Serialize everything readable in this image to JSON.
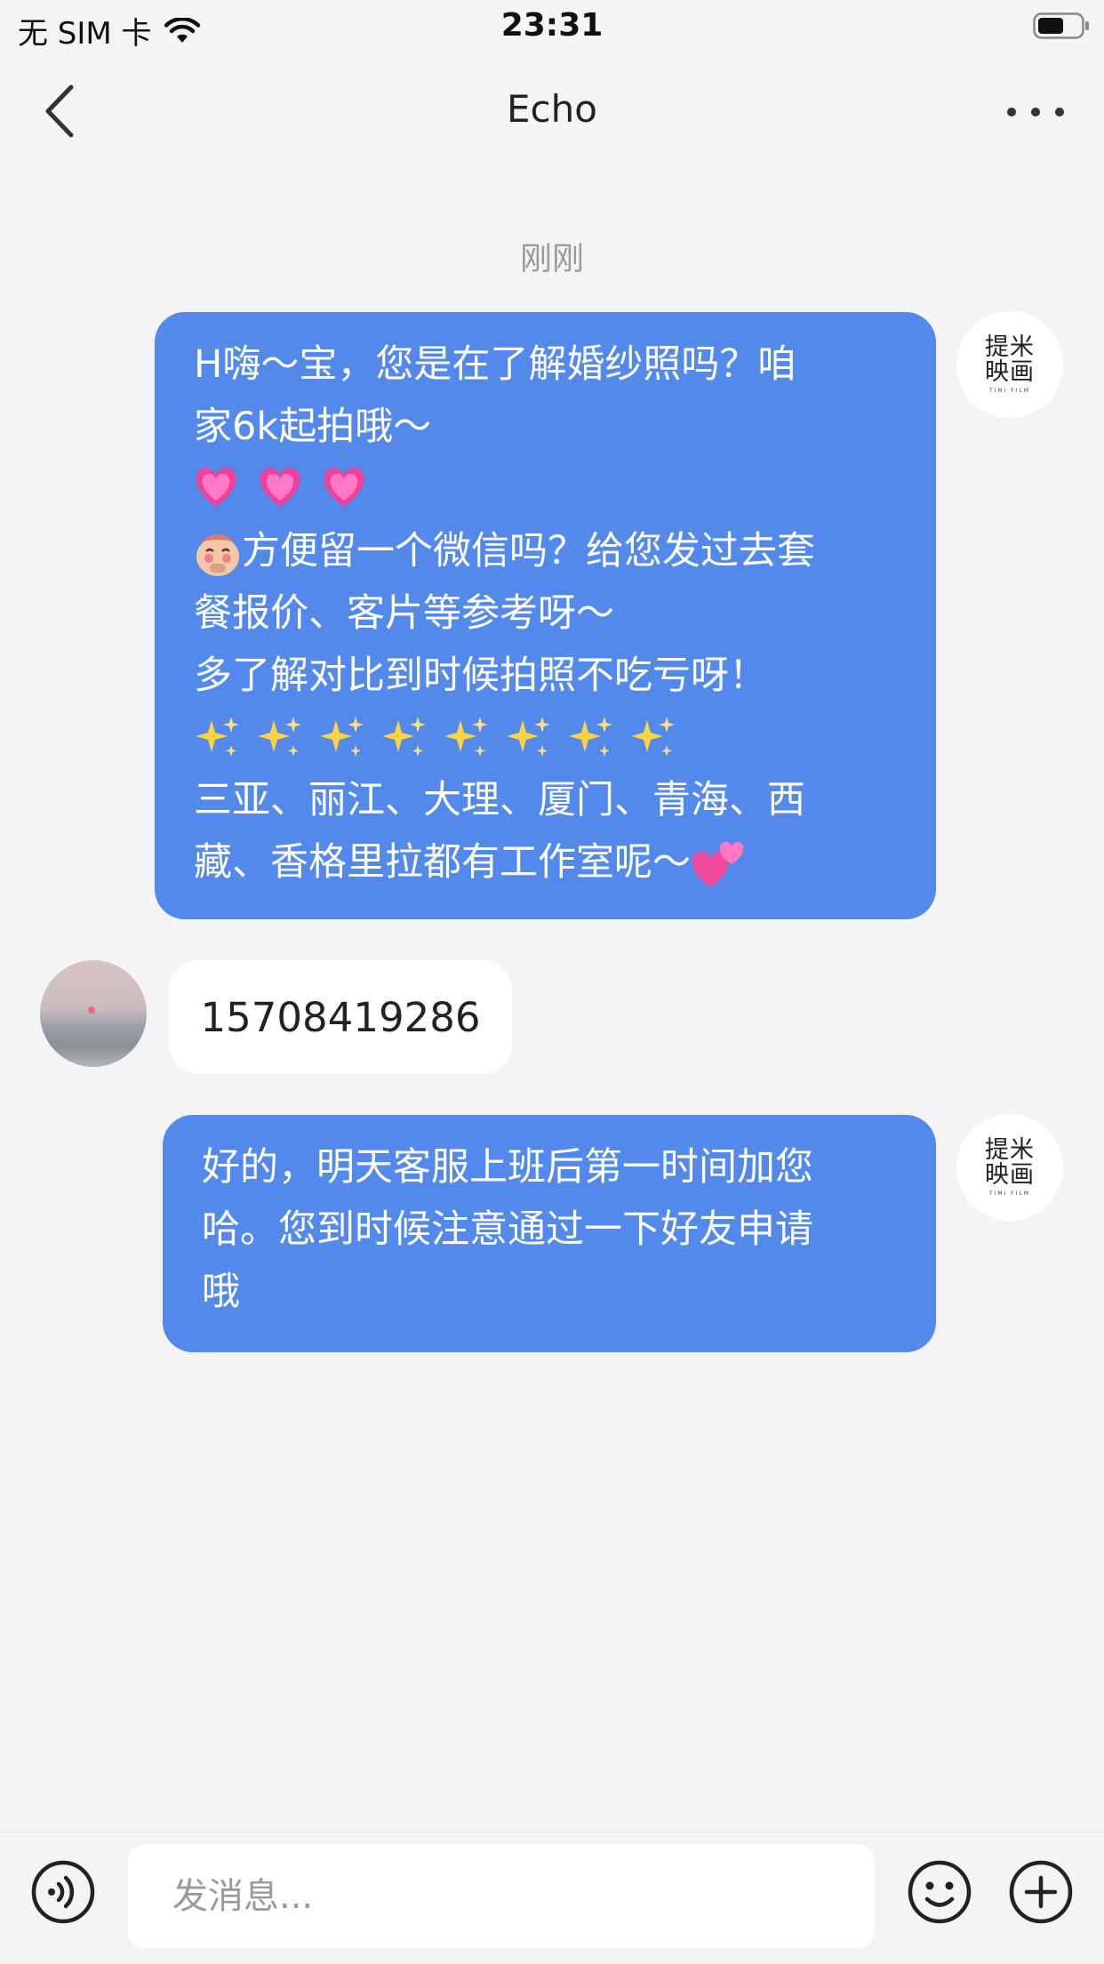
{
  "status_bar": {
    "carrier": "无 SIM 卡",
    "time": "23:31",
    "icons": [
      "wifi-icon",
      "battery-icon"
    ]
  },
  "nav": {
    "title": "Echo",
    "icons": [
      "back-chevron-icon",
      "more-dots-icon"
    ]
  },
  "timestamp": "刚刚",
  "messages": {
    "m1": {
      "line1": "H嗨～宝，您是在了解婚纱照吗？咱",
      "line2": "家6k起拍哦～",
      "hearts_emoji": "💗 💗 💗",
      "line4": "方便留一个微信吗？给您发过去套",
      "line5": "餐报价、客片等参考呀～",
      "line6": "多了解对比到时候拍照不吃亏呀！",
      "sparkles_emoji": "✨✨✨✨✨✨✨✨",
      "line8": "三亚、丽江、大理、厦门、青海、西",
      "line9": "藏、香格里拉都有工作室呢～",
      "trailing_emoji": "💕",
      "avatar_logo": "提米映画"
    },
    "m2": {
      "text": "15708419286"
    },
    "m3": {
      "line1": "好的，明天客服上班后第一时间加您",
      "line2": "哈。您到时候注意通过一下好友申请",
      "line3": "哦",
      "avatar_logo": "提米映画"
    }
  },
  "logo": {
    "line1": "提米",
    "line2": "映画",
    "sub": "TIMI FILM"
  },
  "input_bar": {
    "placeholder": "发消息...",
    "icons": [
      "voice-icon",
      "emoji-icon",
      "plus-icon"
    ]
  },
  "colors": {
    "bubble_out": "#5289ea",
    "bubble_in": "#ffffff",
    "background": "#f4f4f6"
  }
}
